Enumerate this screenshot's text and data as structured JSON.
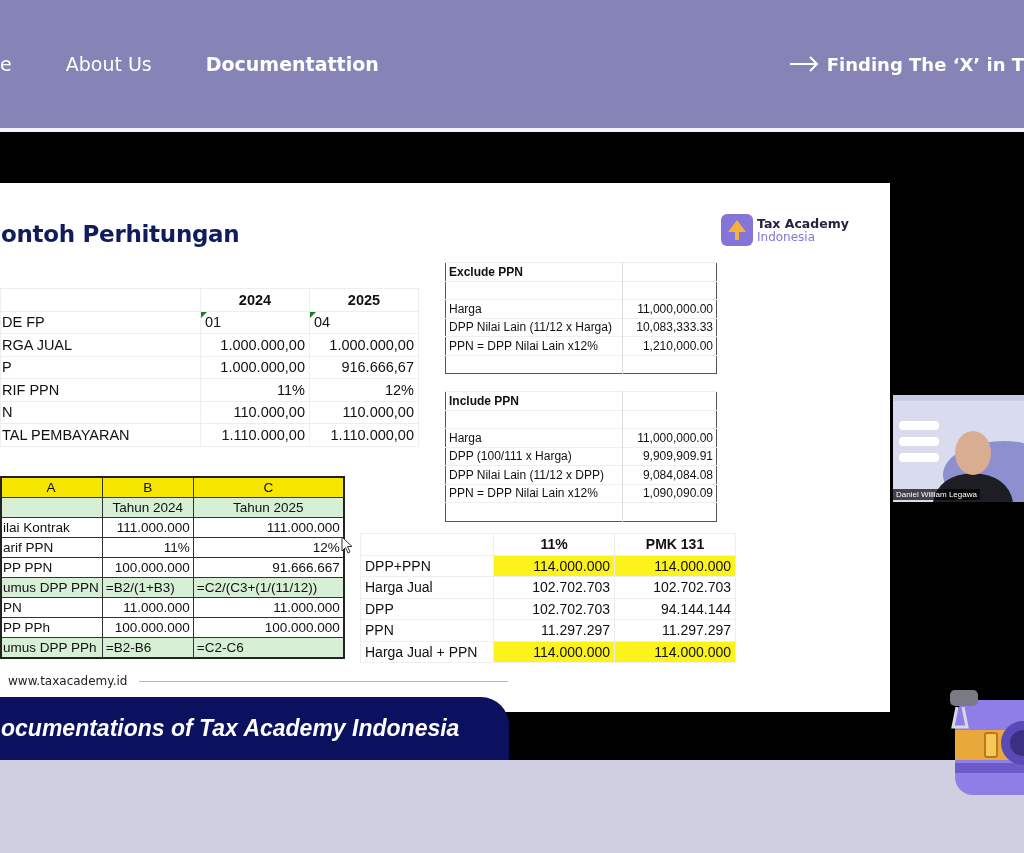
{
  "nav": {
    "links": [
      {
        "label": "e",
        "selected": false
      },
      {
        "label": "About Us",
        "selected": false
      },
      {
        "label": "Documentattion",
        "selected": true
      }
    ],
    "cta": "Finding The ‘X’ in T"
  },
  "slide": {
    "title": "ontoh Perhitungan",
    "logo": {
      "name": "Tax Academy",
      "sub": "Indonesia"
    },
    "year_table": {
      "columns": [
        "2024",
        "2025"
      ],
      "rows": [
        {
          "label": "DE FP",
          "kind": "code",
          "values": [
            "01",
            "04"
          ],
          "flagged": true
        },
        {
          "label": "RGA JUAL",
          "kind": "amount",
          "values": [
            "1.000.000,00",
            "1.000.000,00"
          ],
          "flagged": false
        },
        {
          "label": "P",
          "kind": "amount",
          "values": [
            "1.000.000,00",
            "916.666,67"
          ],
          "flagged": false
        },
        {
          "label": "RIF PPN",
          "kind": "amount",
          "values": [
            "11%",
            "12%"
          ],
          "flagged": false
        },
        {
          "label": "N",
          "kind": "amount",
          "values": [
            "110.000,00",
            "110.000,00"
          ],
          "flagged": false
        },
        {
          "label": "TAL PEMBAYARAN",
          "kind": "amount",
          "values": [
            "1.110.000,00",
            "1.110.000,00"
          ],
          "flagged": false
        }
      ]
    },
    "spreadsheet": {
      "column_headers": [
        "A",
        "B",
        "C"
      ],
      "rows": [
        {
          "kind": "header",
          "values": [
            "Tahun 2024",
            "Tahun 2025"
          ],
          "highlighted": true
        },
        {
          "label": "ilai Kontrak",
          "kind": "number",
          "values": [
            "111.000.000",
            "111.000.000"
          ],
          "highlighted": false
        },
        {
          "label": "arif PPN",
          "kind": "number",
          "values": [
            "11%",
            "12%"
          ],
          "highlighted": false
        },
        {
          "label": "PP PPN",
          "kind": "number",
          "values": [
            "100.000.000",
            "91.666.667"
          ],
          "highlighted": false
        },
        {
          "label": "umus DPP PPN",
          "kind": "formula",
          "values": [
            "=B2/(1+B3)",
            "=C2/(C3+(1/(11/12))"
          ],
          "highlighted": true
        },
        {
          "label": "PN",
          "kind": "number",
          "values": [
            "11.000.000",
            "11.000.000"
          ],
          "highlighted": false
        },
        {
          "label": "PP PPh",
          "kind": "number",
          "values": [
            "100.000.000",
            "100.000.000"
          ],
          "highlighted": false
        },
        {
          "label": "umus DPP PPh",
          "kind": "formula",
          "values": [
            "=B2-B6",
            "=C2-C6"
          ],
          "highlighted": true
        }
      ]
    },
    "exclude_box": {
      "title": "Exclude PPN",
      "rows": [
        {
          "label": "Harga",
          "value": "11,000,000.00"
        },
        {
          "label": "DPP Nilai Lain (11/12 x Harga)",
          "value": "10,083,333.33"
        },
        {
          "label": "PPN = DPP Nilai Lain x12%",
          "value": "1,210,000.00"
        }
      ]
    },
    "include_box": {
      "title": "Include PPN",
      "rows": [
        {
          "label": "Harga",
          "value": "11,000,000.00"
        },
        {
          "label": "DPP (100/111 x Harga)",
          "value": "9,909,909.91"
        },
        {
          "label": "DPP Nilai Lain (11/12 x DPP)",
          "value": "9,084,084.08"
        },
        {
          "label": "PPN = DPP Nilai Lain x12%",
          "value": "1,090,090.09"
        }
      ]
    },
    "rate_table": {
      "columns": [
        "11%",
        "PMK 131"
      ],
      "rows": [
        {
          "label": "DPP+PPN",
          "values": [
            "114.000.000",
            "114.000.000"
          ],
          "highlighted": true
        },
        {
          "label": "Harga Jual",
          "values": [
            "102.702.703",
            "102.702.703"
          ],
          "highlighted": false
        },
        {
          "label": "DPP",
          "values": [
            "102.702.703",
            "94.144.144"
          ],
          "highlighted": false
        },
        {
          "label": "PPN",
          "values": [
            "11.297.297",
            "11.297.297"
          ],
          "highlighted": false
        },
        {
          "label": "Harga Jual + PPN",
          "values": [
            "114.000.000",
            "114.000.000"
          ],
          "highlighted": true
        }
      ]
    },
    "footer_url": "www.taxacademy.id"
  },
  "webcam": {
    "participant": "Daniel William Legawa"
  },
  "banner": "ocumentations of Tax Academy Indonesia"
}
